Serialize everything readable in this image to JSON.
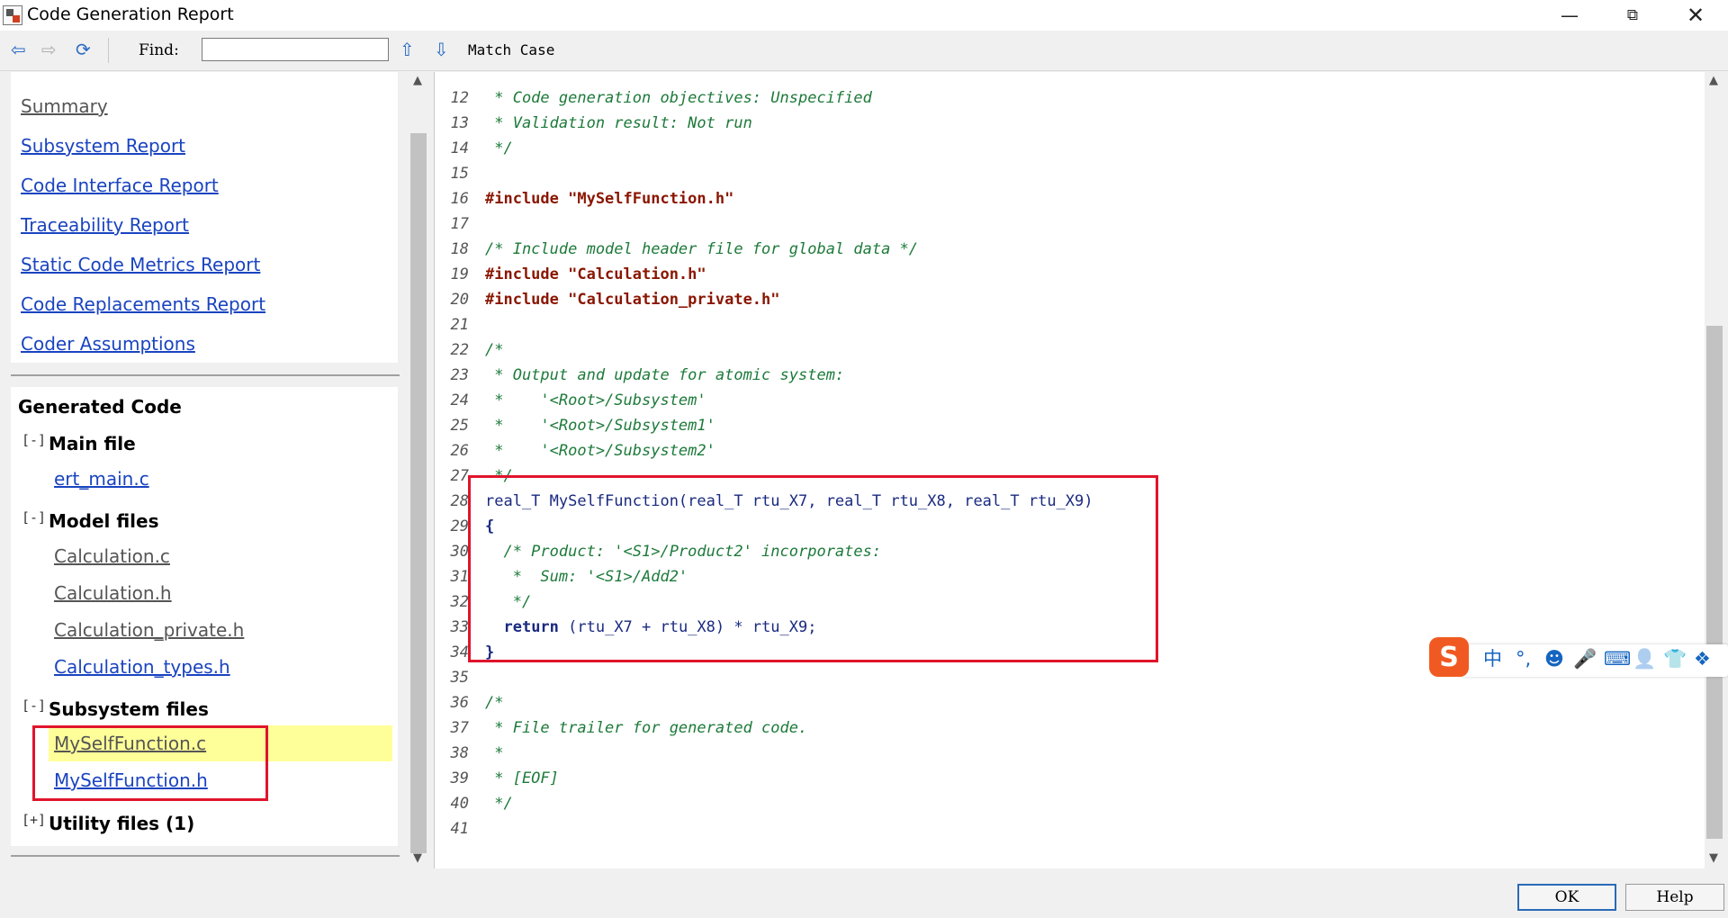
{
  "window": {
    "title": "Code Generation Report",
    "icon": "app-icon",
    "controls": [
      "minimize-icon",
      "restore-icon",
      "close-icon"
    ]
  },
  "toolbar": {
    "back_icon": "arrow-left-icon",
    "forward_icon": "arrow-right-icon",
    "refresh_icon": "refresh-icon",
    "find_label": "Find:",
    "find_value": "",
    "find_up_icon": "arrow-up-icon",
    "find_down_icon": "arrow-down-icon",
    "match_case_label": "Match Case"
  },
  "nav": {
    "links": [
      {
        "label": "Summary",
        "visited": true
      },
      {
        "label": "Subsystem Report",
        "visited": false
      },
      {
        "label": "Code Interface Report",
        "visited": false
      },
      {
        "label": "Traceability Report",
        "visited": false
      },
      {
        "label": "Static Code Metrics Report",
        "visited": false
      },
      {
        "label": "Code Replacements Report",
        "visited": false
      },
      {
        "label": "Coder Assumptions",
        "visited": false
      }
    ]
  },
  "generated_code": {
    "title": "Generated Code",
    "groups": [
      {
        "expander": "[-]",
        "title": "Main file",
        "files": [
          {
            "name": "ert_main.c",
            "visited": false
          }
        ]
      },
      {
        "expander": "[-]",
        "title": "Model files",
        "files": [
          {
            "name": "Calculation.c",
            "visited": true
          },
          {
            "name": "Calculation.h",
            "visited": true
          },
          {
            "name": "Calculation_private.h",
            "visited": true
          },
          {
            "name": "Calculation_types.h",
            "visited": false
          }
        ]
      },
      {
        "expander": "[-]",
        "title": "Subsystem files",
        "files": [
          {
            "name": "MySelfFunction.c",
            "visited": true,
            "selected": true
          },
          {
            "name": "MySelfFunction.h",
            "visited": false
          }
        ]
      },
      {
        "expander": "[+]",
        "title": "Utility files (1)",
        "files": []
      }
    ]
  },
  "code": {
    "lines": [
      {
        "n": "12",
        "t": " * Code generation objectives: Unspecified",
        "k": "comment"
      },
      {
        "n": "13",
        "t": " * Validation result: Not run",
        "k": "comment"
      },
      {
        "n": "14",
        "t": " */",
        "k": "comment"
      },
      {
        "n": "15",
        "t": "",
        "k": "normal"
      },
      {
        "n": "16",
        "t": "#include \"MySelfFunction.h\"",
        "k": "pp"
      },
      {
        "n": "17",
        "t": "",
        "k": "normal"
      },
      {
        "n": "18",
        "t": "/* Include model header file for global data */",
        "k": "comment"
      },
      {
        "n": "19",
        "t": "#include \"Calculation.h\"",
        "k": "pp"
      },
      {
        "n": "20",
        "t": "#include \"Calculation_private.h\"",
        "k": "pp"
      },
      {
        "n": "21",
        "t": "",
        "k": "normal"
      },
      {
        "n": "22",
        "t": "/*",
        "k": "comment"
      },
      {
        "n": "23",
        "t": " * Output and update for atomic system:",
        "k": "comment"
      },
      {
        "n": "24",
        "t": " *    '<Root>/Subsystem'",
        "k": "comment"
      },
      {
        "n": "25",
        "t": " *    '<Root>/Subsystem1'",
        "k": "comment"
      },
      {
        "n": "26",
        "t": " *    '<Root>/Subsystem2'",
        "k": "comment"
      },
      {
        "n": "27",
        "t": " */",
        "k": "comment"
      },
      {
        "n": "28",
        "t": "real_T MySelfFunction(real_T rtu_X7, real_T rtu_X8, real_T rtu_X9)",
        "k": "normal"
      },
      {
        "n": "29",
        "t": "{",
        "k": "kw"
      },
      {
        "n": "30",
        "t": "  /* Product: '<S1>/Product2' incorporates:",
        "k": "comment"
      },
      {
        "n": "31",
        "t": "   *  Sum: '<S1>/Add2'",
        "k": "comment"
      },
      {
        "n": "32",
        "t": "   */",
        "k": "comment"
      },
      {
        "n": "33",
        "t": "  return (rtu_X7 + rtu_X8) * rtu_X9;",
        "k": "return"
      },
      {
        "n": "34",
        "t": "}",
        "k": "kw"
      },
      {
        "n": "35",
        "t": "",
        "k": "normal"
      },
      {
        "n": "36",
        "t": "/*",
        "k": "comment"
      },
      {
        "n": "37",
        "t": " * File trailer for generated code.",
        "k": "comment"
      },
      {
        "n": "38",
        "t": " *",
        "k": "comment"
      },
      {
        "n": "39",
        "t": " * [EOF]",
        "k": "comment"
      },
      {
        "n": "40",
        "t": " */",
        "k": "comment"
      },
      {
        "n": "41",
        "t": "",
        "k": "normal"
      }
    ]
  },
  "ime": {
    "logo": "S",
    "icons": [
      {
        "name": "chinese-mode-icon",
        "glyph": "中"
      },
      {
        "name": "punctuation-icon",
        "glyph": "°,"
      },
      {
        "name": "emoji-icon",
        "glyph": "☻"
      },
      {
        "name": "microphone-icon",
        "glyph": "🎤"
      },
      {
        "name": "keyboard-icon",
        "glyph": "⌨"
      },
      {
        "name": "user-icon",
        "glyph": "👤"
      },
      {
        "name": "skin-icon",
        "glyph": "👕"
      },
      {
        "name": "apps-icon",
        "glyph": "❖"
      }
    ]
  },
  "buttons": {
    "ok": "OK",
    "help": "Help"
  },
  "colors": {
    "link": "#1a44c0",
    "visited": "#555555",
    "highlight": "#ffff99",
    "annotation_red": "#e0142c",
    "comment": "#1d7a3a",
    "preprocessor": "#8a1500"
  }
}
